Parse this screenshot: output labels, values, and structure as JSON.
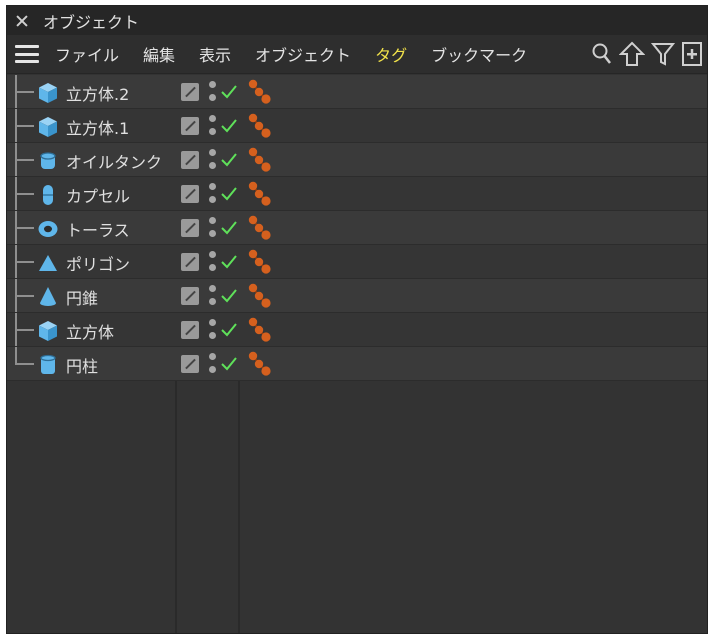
{
  "window": {
    "title": "オブジェクト"
  },
  "menu": {
    "items": [
      {
        "label": "ファイル",
        "active": false
      },
      {
        "label": "編集",
        "active": false
      },
      {
        "label": "表示",
        "active": false
      },
      {
        "label": "オブジェクト",
        "active": false
      },
      {
        "label": "タグ",
        "active": true
      },
      {
        "label": "ブックマーク",
        "active": false
      }
    ],
    "tools": [
      "search-icon",
      "up-arrow-icon",
      "filter-icon",
      "new-window-icon"
    ],
    "active_color": "#f0e14a"
  },
  "objects": [
    {
      "name": "立方体.2",
      "icon": "cube-icon"
    },
    {
      "name": "立方体.1",
      "icon": "cube-icon"
    },
    {
      "name": "オイルタンク",
      "icon": "oil-tank-icon"
    },
    {
      "name": "カプセル",
      "icon": "capsule-icon"
    },
    {
      "name": "トーラス",
      "icon": "torus-icon"
    },
    {
      "name": "ポリゴン",
      "icon": "polygon-icon"
    },
    {
      "name": "円錐",
      "icon": "cone-icon"
    },
    {
      "name": "立方体",
      "icon": "cube-icon"
    },
    {
      "name": "円柱",
      "icon": "cylinder-icon"
    }
  ],
  "colors": {
    "icon_blue": "#5fb6ea",
    "check_green": "#5fe15a",
    "tag_orange": "#d5601e"
  }
}
